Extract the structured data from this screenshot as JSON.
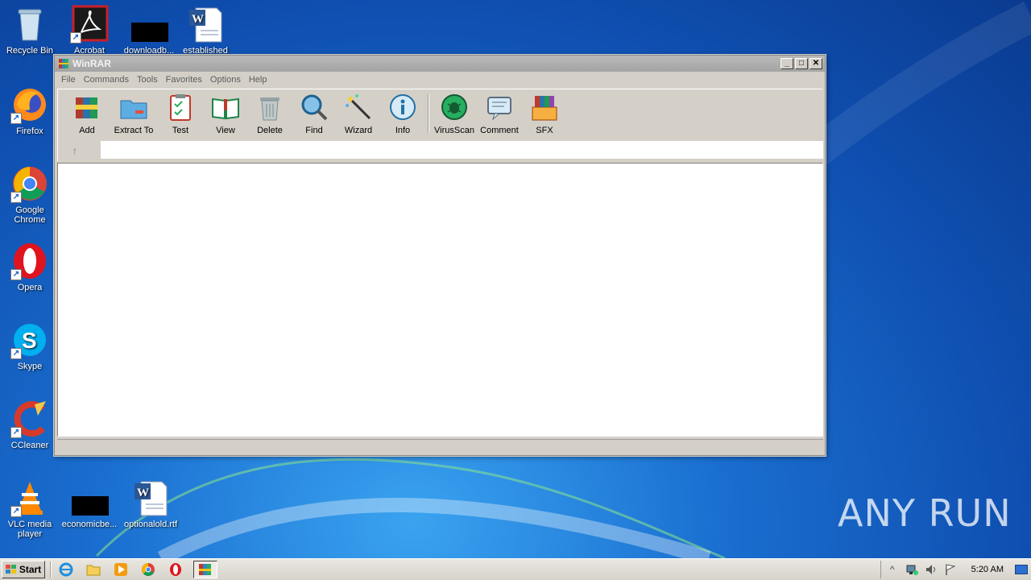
{
  "desktop": {
    "icons": [
      {
        "label": "Recycle Bin"
      },
      {
        "label": "Acrobat"
      },
      {
        "label": "downloadb..."
      },
      {
        "label": "established"
      },
      {
        "label": "Firefox"
      },
      {
        "label": "Google Chrome"
      },
      {
        "label": "Opera"
      },
      {
        "label": "Skype"
      },
      {
        "label": "CCleaner"
      },
      {
        "label": "VLC media player"
      },
      {
        "label": "economicbe..."
      },
      {
        "label": "optionalold.rtf"
      }
    ]
  },
  "window": {
    "title": "WinRAR",
    "controls": {
      "minimize": "_",
      "maximize": "□",
      "close": "✕"
    },
    "menu": [
      "File",
      "Commands",
      "Tools",
      "Favorites",
      "Options",
      "Help"
    ],
    "toolbar": [
      {
        "label": "Add",
        "icon": "add-icon"
      },
      {
        "label": "Extract To",
        "icon": "extract-icon"
      },
      {
        "label": "Test",
        "icon": "test-icon"
      },
      {
        "label": "View",
        "icon": "view-icon"
      },
      {
        "label": "Delete",
        "icon": "delete-icon"
      },
      {
        "label": "Find",
        "icon": "find-icon"
      },
      {
        "label": "Wizard",
        "icon": "wizard-icon"
      },
      {
        "label": "Info",
        "icon": "info-icon"
      },
      {
        "label": "VirusScan",
        "icon": "virusscan-icon"
      },
      {
        "label": "Comment",
        "icon": "comment-icon"
      },
      {
        "label": "SFX",
        "icon": "sfx-icon"
      }
    ],
    "address": {
      "value": "",
      "up_glyph": "↑"
    }
  },
  "taskbar": {
    "start_label": "Start",
    "clock": "5:20 AM",
    "tray_expand": "^"
  },
  "watermark": "ANY RUN"
}
